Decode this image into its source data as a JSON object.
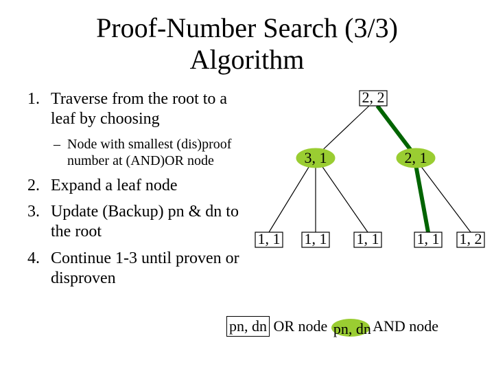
{
  "title_line1": "Proof-Number Search (3/3)",
  "title_line2": "Algorithm",
  "steps": {
    "n1": "1.",
    "t1": "Traverse from the root to a leaf by choosing",
    "dash": "–",
    "sub": "Node with smallest (dis)proof number at (AND)OR node",
    "n2": "2.",
    "t2": "Expand a leaf node",
    "n3": "3.",
    "t3": "Update (Backup) pn & dn to the root",
    "n4": "4.",
    "t4": "Continue 1-3 until proven or disproven"
  },
  "tree": {
    "root": "2, 2",
    "l2a": "3, 1",
    "l2b": "2, 1",
    "leaf1": "1, 1",
    "leaf2": "1, 1",
    "leaf3": "1, 1",
    "leaf4": "1, 1",
    "leaf5": "1, 2"
  },
  "legend": {
    "pn_dn": "pn, dn",
    "or": " OR node  ",
    "and": " AND node"
  }
}
